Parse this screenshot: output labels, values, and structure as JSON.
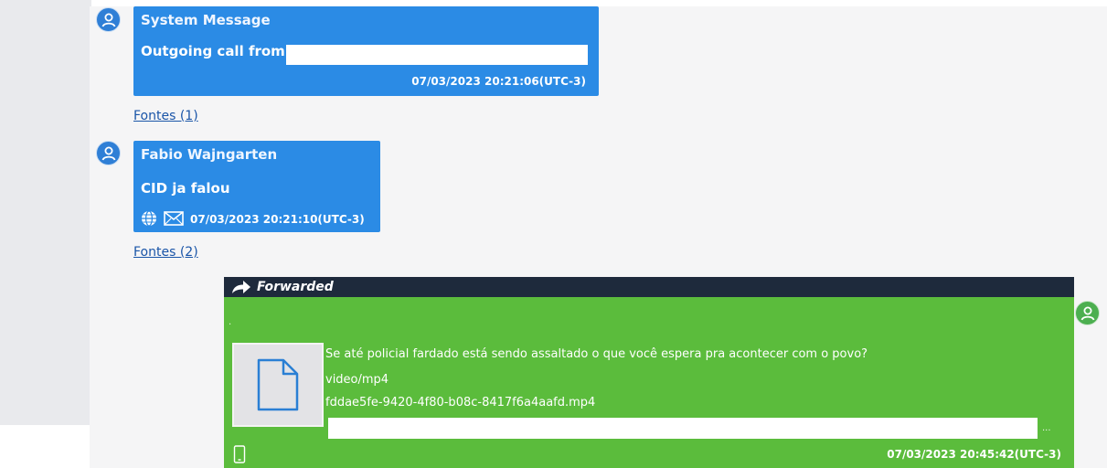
{
  "messages": [
    {
      "sender": "System Message",
      "text": "Outgoing call from",
      "timestamp": "07/03/2023 20:21:06(UTC-3)",
      "sources_link": "Fontes (1)"
    },
    {
      "sender": "Fabio  Wajngarten",
      "text": "CID ja falou",
      "timestamp": "07/03/2023 20:21:10(UTC-3)",
      "sources_link": "Fontes (2)",
      "icons": [
        "globe-icon",
        "envelope-icon"
      ]
    }
  ],
  "forwarded": {
    "label": "Forwarded",
    "caption": "Se até policial fardado está sendo assaltado o que você espera pra acontecer com o povo?",
    "mime": "video/mp4",
    "filename": "fddae5fe-9420-4f80-b08c-8417f6a4aafd.mp4",
    "timestamp": "07/03/2023 20:45:42(UTC-3)",
    "icons": [
      "forward-arrow-icon",
      "file-icon",
      "phone-icon"
    ]
  },
  "colors": {
    "blue_bubble": "#2b8be5",
    "green_bubble": "#5bbc3c",
    "forward_header": "#1e2a3c",
    "link": "#1a55a8"
  }
}
